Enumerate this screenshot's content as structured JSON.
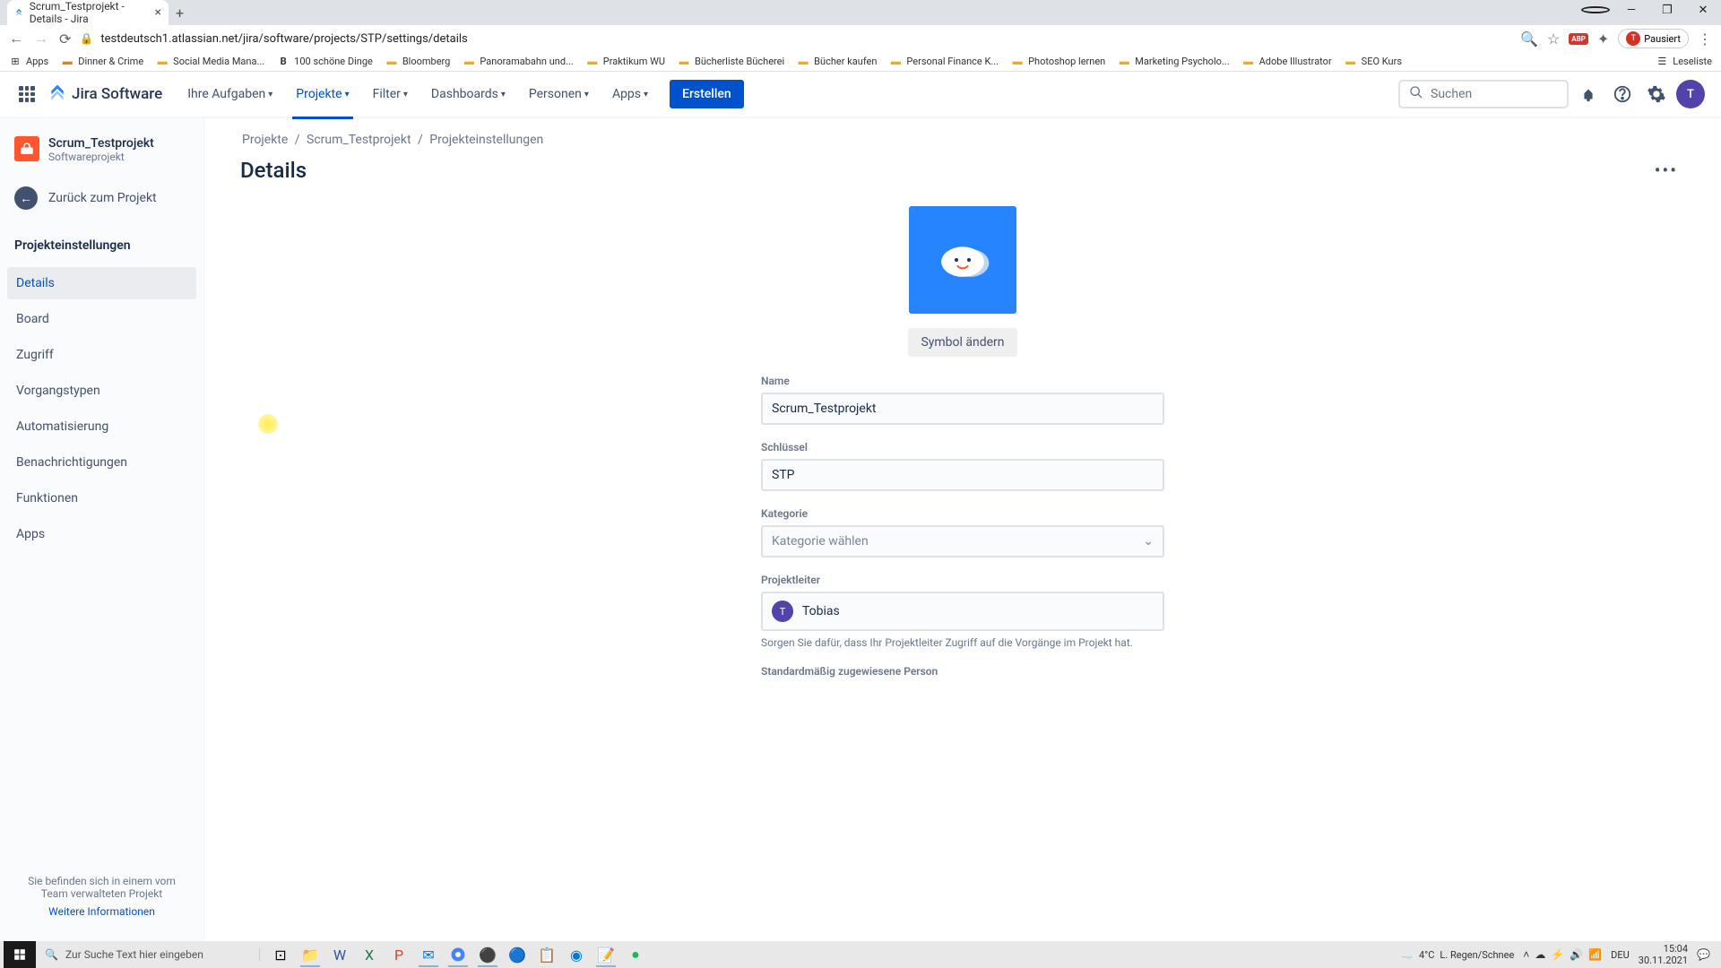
{
  "browser": {
    "tab_title": "Scrum_Testprojekt - Details - Jira",
    "url": "testdeutsch1.atlassian.net/jira/software/projects/STP/settings/details",
    "paused_label": "Pausiert",
    "bookmarks": {
      "apps": "Apps",
      "b1": "Dinner & Crime",
      "b2": "Social Media Mana...",
      "b3": "100 schöne Dinge",
      "b4": "Bloomberg",
      "b5": "Panoramabahn und...",
      "b6": "Praktikum WU",
      "b7": "Bücherliste Bücherei",
      "b8": "Bücher kaufen",
      "b9": "Personal Finance K...",
      "b10": "Photoshop lernen",
      "b11": "Marketing Psycholo...",
      "b12": "Adobe Illustrator",
      "b13": "SEO Kurs",
      "reading": "Leseliste"
    }
  },
  "header": {
    "product": "Jira Software",
    "nav": {
      "tasks": "Ihre Aufgaben",
      "projects": "Projekte",
      "filters": "Filter",
      "dashboards": "Dashboards",
      "people": "Personen",
      "apps": "Apps"
    },
    "create": "Erstellen",
    "search_placeholder": "Suchen"
  },
  "sidebar": {
    "project_name": "Scrum_Testprojekt",
    "project_type": "Softwareprojekt",
    "back": "Zurück zum Projekt",
    "heading": "Projekteinstellungen",
    "items": {
      "details": "Details",
      "board": "Board",
      "access": "Zugriff",
      "issuetypes": "Vorgangstypen",
      "automation": "Automatisierung",
      "notifications": "Benachrichtigungen",
      "features": "Funktionen",
      "apps": "Apps"
    },
    "footer_text": "Sie befinden sich in einem vom Team verwalteten Projekt",
    "footer_link": "Weitere Informationen"
  },
  "breadcrumb": {
    "projects": "Projekte",
    "name": "Scrum_Testprojekt",
    "settings": "Projekteinstellungen"
  },
  "page": {
    "title": "Details",
    "change_symbol": "Symbol ändern",
    "labels": {
      "name": "Name",
      "key": "Schlüssel",
      "category": "Kategorie",
      "lead": "Projektleiter",
      "default_assignee": "Standardmäßig zugewiesene Person"
    },
    "values": {
      "name": "Scrum_Testprojekt",
      "key": "STP",
      "category_placeholder": "Kategorie wählen",
      "lead": "Tobias"
    },
    "lead_hint": "Sorgen Sie dafür, dass Ihr Projektleiter Zugriff auf die Vorgänge im Projekt hat."
  },
  "taskbar": {
    "search_placeholder": "Zur Suche Text hier eingeben",
    "weather_temp": "4°C",
    "weather_text": "L. Regen/Schnee",
    "lang": "DEU",
    "time": "15:04",
    "date": "30.11.2021"
  }
}
